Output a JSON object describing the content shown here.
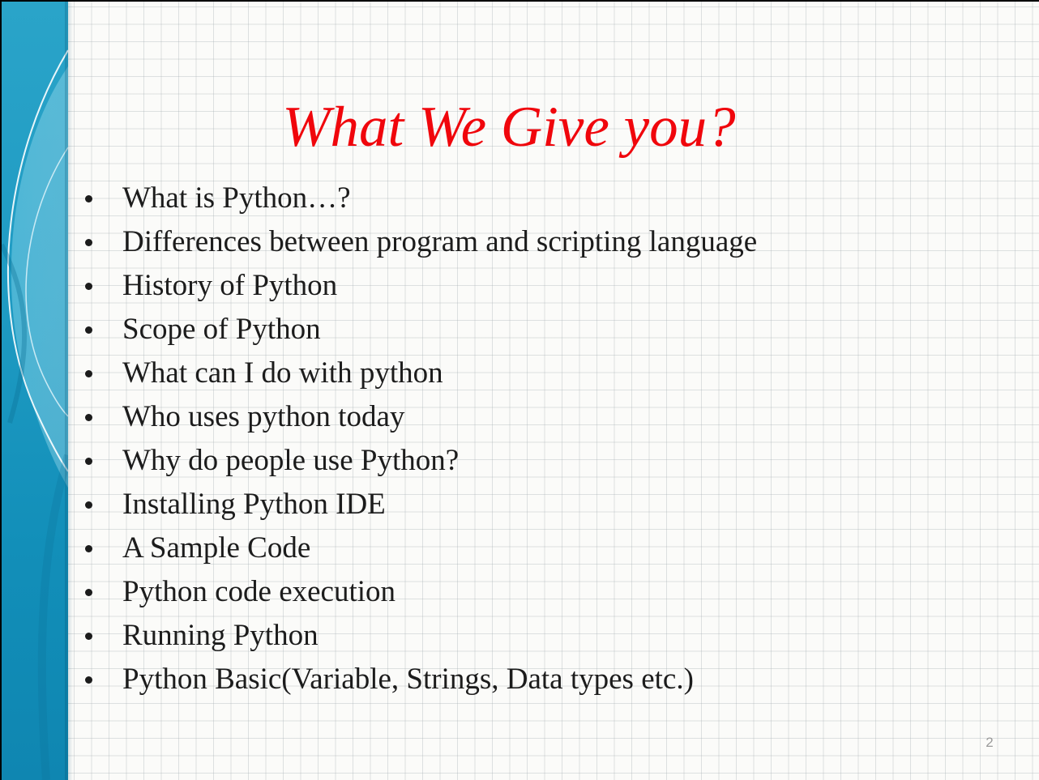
{
  "slide": {
    "title": "What We Give you?",
    "bullets": [
      {
        "text": "What is Python…?"
      },
      {
        "text": "Differences between program and scripting language"
      },
      {
        "text": "History of Python"
      },
      {
        "text": "Scope of Python"
      },
      {
        "text": "What can I do with python"
      },
      {
        "text": "Who uses python today"
      },
      {
        "text": "Why do people use Python?"
      },
      {
        "text": "Installing Python IDE"
      },
      {
        "text": "A Sample Code"
      },
      {
        "text": "Python code execution"
      },
      {
        "text": "Running Python"
      },
      {
        "text": "Python Basic(Variable, Strings, Data types etc.)"
      }
    ],
    "page_number": "2"
  },
  "colors": {
    "title": "#f0060c",
    "body_text": "#1c1c1c",
    "side_band": "#1e9ac2",
    "grid_line": "#aab2b8",
    "background": "#fbfbf9"
  }
}
